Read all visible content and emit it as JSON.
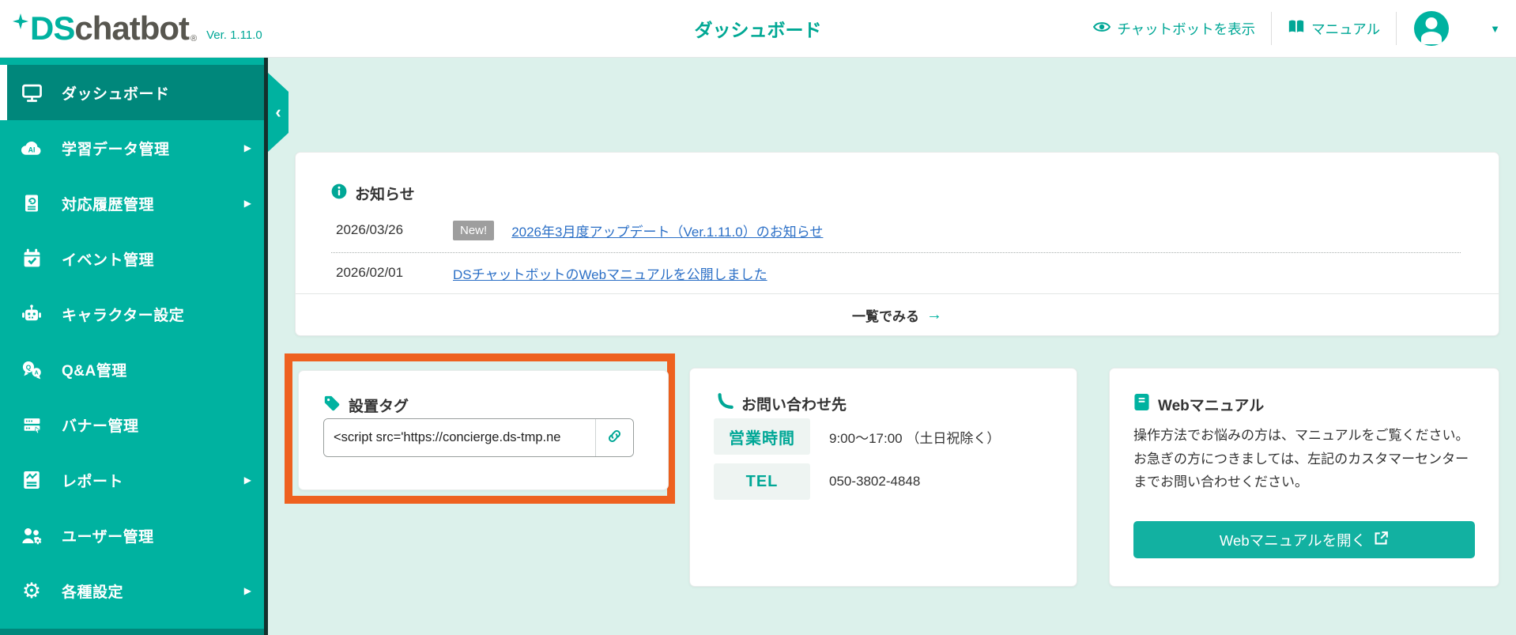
{
  "colors": {
    "brand_teal": "#00B2A0",
    "brand_dark_teal": "#00877B",
    "mint_background": "#DCF1EB",
    "highlight_orange": "#EE611F",
    "link_blue": "#2B6FC6",
    "badge_gray": "#9E9E9E"
  },
  "glyphs": {
    "submenu": "▶",
    "caret": "▼",
    "collapse": "‹",
    "arrow_right": "→",
    "gear": "⚙"
  },
  "header": {
    "logo_ds": "DS",
    "logo_rest": "chatbot",
    "logo_reg": "®",
    "version": "Ver. 1.11.0",
    "page_title": "ダッシュボード",
    "actions": {
      "show_chatbot": "チャットボットを表示",
      "manual": "マニュアル"
    }
  },
  "sidebar": {
    "items": [
      {
        "label": "ダッシュボード",
        "icon": "monitor-icon",
        "active": true,
        "has_submenu": false
      },
      {
        "label": "学習データ管理",
        "icon": "ai-cloud-icon",
        "active": false,
        "has_submenu": true
      },
      {
        "label": "対応履歴管理",
        "icon": "history-doc-icon",
        "active": false,
        "has_submenu": true
      },
      {
        "label": "イベント管理",
        "icon": "calendar-check-icon",
        "active": false,
        "has_submenu": false
      },
      {
        "label": "キャラクター設定",
        "icon": "robot-icon",
        "active": false,
        "has_submenu": false
      },
      {
        "label": "Q&A管理",
        "icon": "qa-bubbles-icon",
        "active": false,
        "has_submenu": false
      },
      {
        "label": "バナー管理",
        "icon": "banner-icon",
        "active": false,
        "has_submenu": false
      },
      {
        "label": "レポート",
        "icon": "report-chart-icon",
        "active": false,
        "has_submenu": true
      },
      {
        "label": "ユーザー管理",
        "icon": "users-icon",
        "active": false,
        "has_submenu": false
      },
      {
        "label": "各種設定",
        "icon": "gear-icon",
        "active": false,
        "has_submenu": true
      }
    ]
  },
  "news": {
    "title": "お知らせ",
    "items": [
      {
        "date": "2026/03/26",
        "badge": "New!",
        "link": "2026年3月度アップデート（Ver.1.11.0）のお知らせ"
      },
      {
        "date": "2026/02/01",
        "badge": "",
        "link": "DSチャットボットのWebマニュアルを公開しました"
      }
    ],
    "view_all": "一覧でみる"
  },
  "tag_card": {
    "title": "設置タグ",
    "input_value": "<script src='https://concierge.ds-tmp.ne"
  },
  "contact_card": {
    "title": "お問い合わせ先",
    "rows": [
      {
        "label": "営業時間",
        "value": "9:00〜17:00 （土日祝除く）"
      },
      {
        "label": "TEL",
        "value": "050-3802-4848"
      }
    ]
  },
  "manual_card": {
    "title": "Webマニュアル",
    "body_lines": [
      "操作方法でお悩みの方は、マニュアルをご覧ください。",
      "お急ぎの方につきましては、左記のカスタマーセンターまでお問い合わせください。"
    ],
    "button_label": "Webマニュアルを開く"
  }
}
